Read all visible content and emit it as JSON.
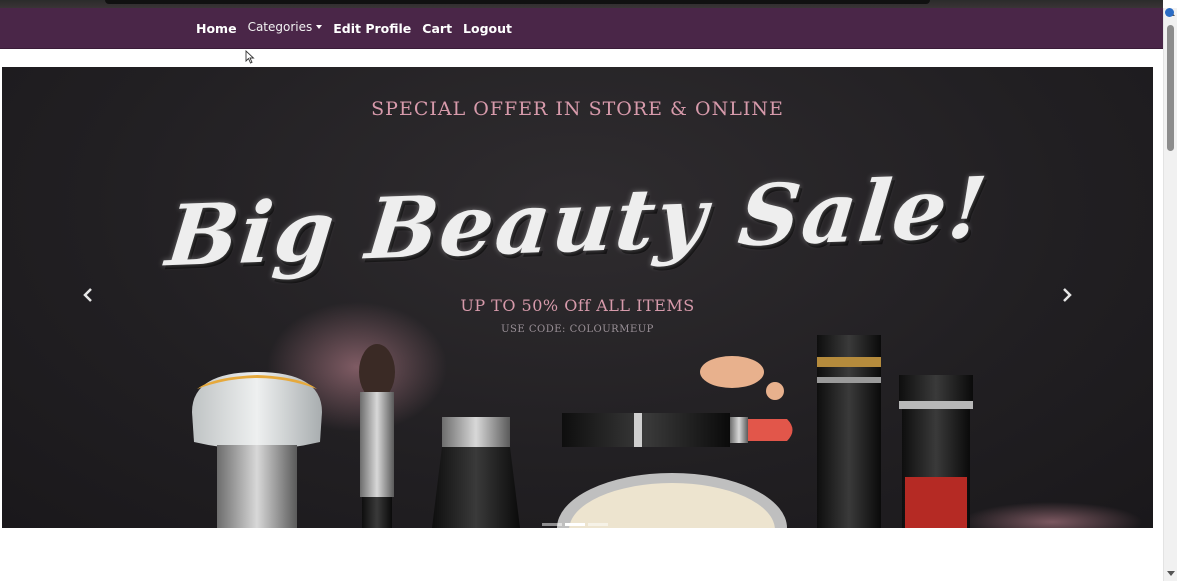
{
  "navbar": {
    "links": [
      "Home",
      "Categories",
      "Edit Profile",
      "Cart",
      "Logout"
    ]
  },
  "carousel": {
    "offer_text": "SPECIAL OFFER IN STORE & ONLINE",
    "headline": "Big Beauty Sale!",
    "discount_text": "UP TO 50% Off ALL ITEMS",
    "code_text": "USE CODE: COLOURMEUP",
    "prev_icon": "chevron-left-icon",
    "next_icon": "chevron-right-icon",
    "slide_count": 3,
    "active_slide": 2
  },
  "colors": {
    "navbar": "#4a2648",
    "accent_pink": "#d79aab",
    "banner_bg": "#211f22"
  }
}
